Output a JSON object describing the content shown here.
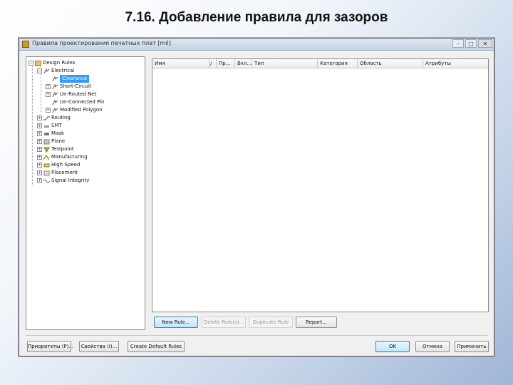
{
  "slide": {
    "title": "7.16. Добавление правила для зазоров"
  },
  "window": {
    "title": "Правила проектирования печатных плат [mil]",
    "controls": {
      "minimize": "–",
      "maximize": "□",
      "close": "✕"
    }
  },
  "tree": {
    "items": [
      {
        "label": "Design Rules",
        "icon": "design-rules-icon",
        "expander": "−",
        "level": 0
      },
      {
        "label": "Electrical",
        "icon": "electrical-icon",
        "expander": "−",
        "level": 1
      },
      {
        "label": "Clearance",
        "icon": "rule-icon",
        "expander": "",
        "level": 2,
        "selected": true
      },
      {
        "label": "Short-Circuit",
        "icon": "rule-icon",
        "expander": "+",
        "level": 2
      },
      {
        "label": "Un-Routed Net",
        "icon": "rule-icon",
        "expander": "+",
        "level": 2
      },
      {
        "label": "Un-Connected Pin",
        "icon": "rule-icon",
        "expander": "",
        "level": 2
      },
      {
        "label": "Modified Polygon",
        "icon": "rule-icon",
        "expander": "+",
        "level": 2
      },
      {
        "label": "Routing",
        "icon": "routing-icon",
        "expander": "+",
        "level": 1
      },
      {
        "label": "SMT",
        "icon": "smt-icon",
        "expander": "+",
        "level": 1
      },
      {
        "label": "Mask",
        "icon": "mask-icon",
        "expander": "+",
        "level": 1
      },
      {
        "label": "Plane",
        "icon": "plane-icon",
        "expander": "+",
        "level": 1
      },
      {
        "label": "Testpoint",
        "icon": "testpoint-icon",
        "expander": "+",
        "level": 1
      },
      {
        "label": "Manufacturing",
        "icon": "manufacturing-icon",
        "expander": "+",
        "level": 1
      },
      {
        "label": "High Speed",
        "icon": "high-speed-icon",
        "expander": "+",
        "level": 1
      },
      {
        "label": "Placement",
        "icon": "placement-icon",
        "expander": "+",
        "level": 1
      },
      {
        "label": "Signal Integrity",
        "icon": "signal-integrity-icon",
        "expander": "+",
        "level": 1
      }
    ]
  },
  "rules_table": {
    "columns": [
      "Имя",
      "/",
      "Пр...",
      "Вкл...",
      "Тип",
      "Категория",
      "Область",
      "Атрибуты"
    ]
  },
  "panel_buttons": {
    "new_rule": "New Rule...",
    "delete_rule": "Delete Rule(s)...",
    "duplicate_rule": "Duplicate Rule",
    "report": "Report..."
  },
  "footer_buttons": {
    "priorities": "Приоритеты (P)...",
    "properties": "Свойства (I)...",
    "create_default": "Create Default Rules",
    "ok": "OK",
    "cancel": "Отмена",
    "apply": "Применить"
  },
  "colors": {
    "selection": "#3399ff",
    "window_bg": "#f0f0f0",
    "ok_border": "#3c7fb1"
  }
}
